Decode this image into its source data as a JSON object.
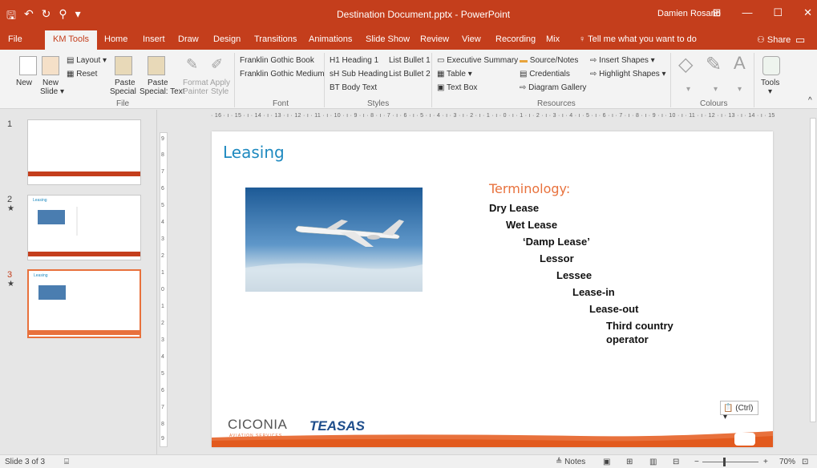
{
  "titlebar": {
    "title": "Destination Document.pptx  -  PowerPoint",
    "user": "Damien Rosario",
    "save_icon": "floppy-icon",
    "undo_icon": "undo-icon",
    "redo_icon": "redo-icon",
    "minimize": "—",
    "restore": "☐",
    "close": "✕"
  },
  "tabs": [
    "File",
    "KM Tools",
    "Home",
    "Insert",
    "Draw",
    "Design",
    "Transitions",
    "Animations",
    "Slide Show",
    "Review",
    "View",
    "Recording",
    "Mix"
  ],
  "active_tab": "KM Tools",
  "tell_me": "Tell me what you want to do",
  "share": "Share",
  "ribbon": {
    "new": "New",
    "new_slide": "New",
    "new_slide_2": "Slide ▾",
    "layout": "Layout ▾",
    "reset": "Reset",
    "paste_special_1": "Paste",
    "paste_special_2": "Special",
    "paste_text_1": "Paste",
    "paste_text_2": "Special: Text",
    "format_painter_1": "Format",
    "format_painter_2": "Painter",
    "apply_style_1": "Apply",
    "apply_style_2": "Style",
    "group_file": "File",
    "font_1": "Franklin Gothic Book",
    "font_2": "Franklin Gothic Medium",
    "group_font": "Font",
    "style_h1": "H1 Heading 1",
    "style_sh": "sH Sub Heading",
    "style_bt": "BT Body Text",
    "style_lb1": "List Bullet 1",
    "style_lb2": "List Bullet 2",
    "group_styles": "Styles",
    "exec_summary": "Executive Summary",
    "table": "Table ▾",
    "text_box": "Text Box",
    "source_notes": "Source/Notes",
    "credentials": "Credentials",
    "diagram_gallery": "Diagram Gallery",
    "insert_shapes": "Insert Shapes ▾",
    "highlight_shapes": "Highlight Shapes ▾",
    "group_resources": "Resources",
    "group_colours": "Colours",
    "tools": "Tools",
    "tools_arrow": "▾"
  },
  "thumbnails": [
    {
      "num": "1",
      "star": ""
    },
    {
      "num": "2",
      "star": "★"
    },
    {
      "num": "3",
      "star": "★"
    }
  ],
  "ruler_h": "· 16 · ı · 15 · ı · 14 · ı · 13 · ı · 12 · ı · 11 · ı · 10 · ı · 9 · ı · 8 · ı · 7 · ı · 6 · ı · 5 · ı · 4 · ı · 3 · ı · 2 · ı · 1 · ı · 0 · ı · 1 · ı · 2 · ı · 3 · ı · 4 · ı · 5 · ı · 6 · ı · 7 · ı · 8 · ı · 9 · ı · 10 · ı · 11 · ı · 12 · ı · 13 · ı · 14 · ı · 15 · ı · 16 ·",
  "ruler_v": [
    "9",
    "8",
    "7",
    "6",
    "5",
    "4",
    "3",
    "2",
    "1",
    "0",
    "1",
    "2",
    "3",
    "4",
    "5",
    "6",
    "7",
    "8",
    "9"
  ],
  "slide": {
    "title": "Leasing",
    "terminology_heading": "Terminology:",
    "terms": [
      "Dry Lease",
      "Wet Lease",
      "‘Damp Lease’",
      "Lessor",
      "Lessee",
      "Lease-in",
      "Lease-out",
      "Third country",
      "operator"
    ],
    "logo_ciconia": "CICONIA",
    "logo_ciconia_sub": "AVIATION SERVICES",
    "logo_teasas": "TEASAS"
  },
  "paste_badge": "(Ctrl) ▾",
  "status": {
    "slide_count": "Slide 3 of 3",
    "notes": "Notes",
    "zoom": "70%",
    "zoom_minus": "−",
    "zoom_plus": "+"
  },
  "colors": {
    "ribbon_red": "#c43e1c",
    "accent_orange": "#e8713c",
    "title_blue": "#1f8ac0",
    "teasas_blue": "#1f4e8c"
  }
}
